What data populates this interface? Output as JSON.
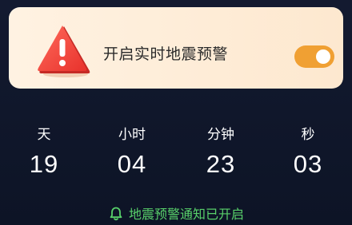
{
  "alert_card": {
    "title": "开启实时地震预警",
    "toggle_on": true,
    "icon": "warning-triangle-icon",
    "toggle_color": "#f0a033"
  },
  "countdown": {
    "units": [
      {
        "label": "天",
        "value": "19"
      },
      {
        "label": "小时",
        "value": "04"
      },
      {
        "label": "分钟",
        "value": "23"
      },
      {
        "label": "秒",
        "value": "03"
      }
    ]
  },
  "notice": {
    "icon": "bell-icon",
    "text": "地震预警通知已开启",
    "color": "#58d06a"
  }
}
